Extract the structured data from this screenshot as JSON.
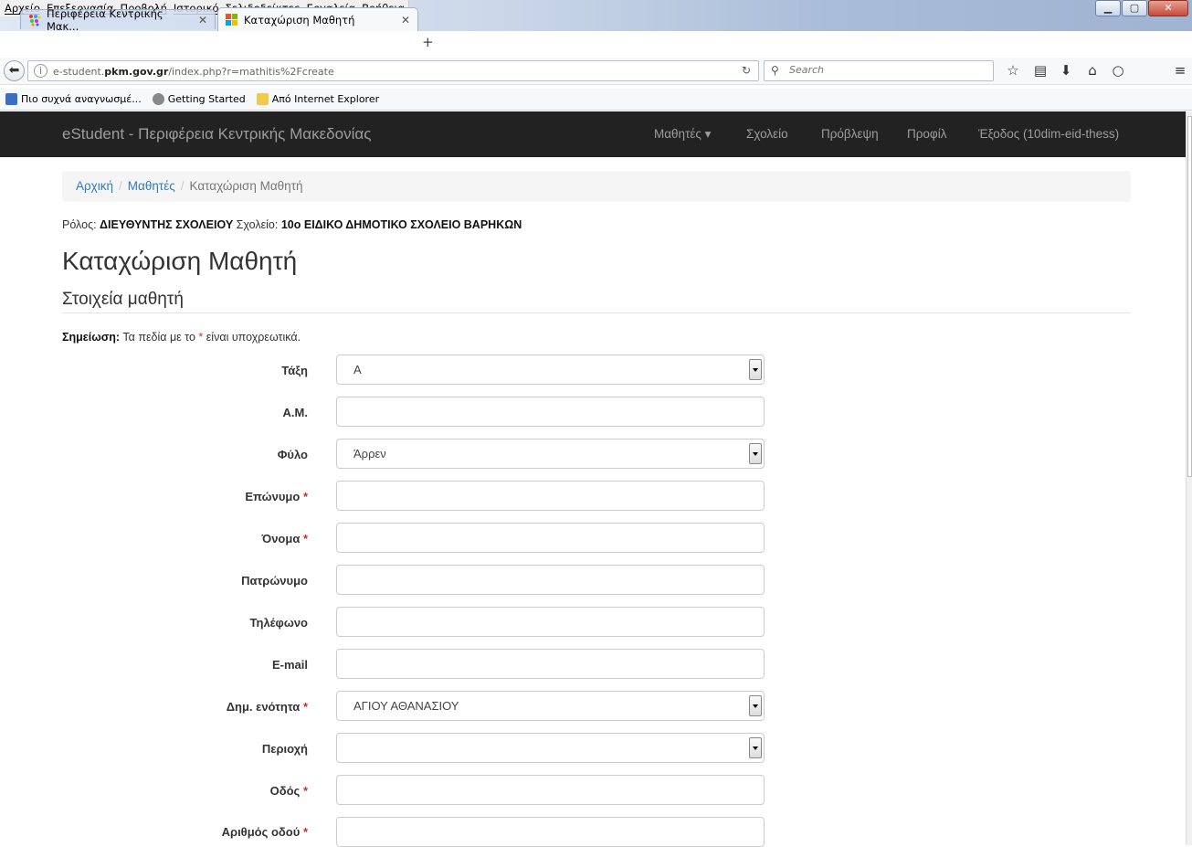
{
  "browser": {
    "menu": [
      "Αρχείο",
      "Επεξεργασία",
      "Προβολή",
      "Ιστορικό",
      "Σελιδοδείκτες",
      "Εργαλεία",
      "Βοήθεια"
    ],
    "tabs": [
      {
        "title": "Περιφέρεια Κεντρικής Μακ...",
        "active": false
      },
      {
        "title": "Καταχώριση Μαθητή",
        "active": true
      }
    ],
    "url_prefix": "e-student.",
    "url_domain": "pkm.gov.gr",
    "url_path": "/index.php?r=mathitis%2Fcreate",
    "search_placeholder": "Search",
    "bookmarks": [
      "Πιο συχνά αναγνωσμέ...",
      "Getting Started",
      "Από Internet Explorer"
    ]
  },
  "site": {
    "brand": "eStudent - Περιφέρεια Κεντρικής Μακεδονίας",
    "nav": [
      "Μαθητές ▾",
      "Σχολείο",
      "Πρόβλεψη",
      "Προφίλ",
      "Έξοδος (10dim-eid-thess)"
    ]
  },
  "breadcrumb": {
    "home": "Αρχική",
    "students": "Μαθητές",
    "current": "Καταχώριση Μαθητή",
    "sep": "/"
  },
  "role": {
    "role_label": "Ρόλος:",
    "role_value": "ΔΙΕΥΘΥΝΤΗΣ ΣΧΟΛΕΙΟΥ",
    "school_label": "Σχολείο:",
    "school_value": "10ο ΕΙΔΙΚΟ ΔΗΜΟΤΙΚΟ ΣΧΟΛΕΙΟ ΒΑΡΗΚΩΝ"
  },
  "page_title": "Καταχώριση Μαθητή",
  "section_title": "Στοιχεία μαθητή",
  "note": {
    "label": "Σημείωση:",
    "text_before": " Τα πεδία με το ",
    "star": "*",
    "text_after": " είναι υποχρεωτικά."
  },
  "form": {
    "taxi_label": "Τάξη",
    "taxi_value": "Α",
    "am_label": "Α.Μ.",
    "am_value": "",
    "fylo_label": "Φύλο",
    "fylo_value": "Άρρεν",
    "eponymo_label": "Επώνυμο",
    "eponymo_value": "",
    "onoma_label": "Όνομα",
    "onoma_value": "",
    "patronymo_label": "Πατρώνυμο",
    "patronymo_value": "",
    "tilefono_label": "Τηλέφωνο",
    "tilefono_value": "",
    "email_label": "E-mail",
    "email_value": "",
    "dimenotita_label": "Δημ. ενότητα",
    "dimenotita_value": "ΑΓΙΟΥ ΑΘΑΝΑΣΙΟΥ",
    "periochi_label": "Περιοχή",
    "periochi_value": "",
    "odos_label": "Οδός",
    "odos_value": "",
    "arithmos_label": "Αριθμός οδού",
    "arithmos_value": "",
    "required_mark": "*"
  },
  "colors": {
    "navbar": "#222222",
    "link": "#337ab7",
    "required": "#c9302c"
  }
}
